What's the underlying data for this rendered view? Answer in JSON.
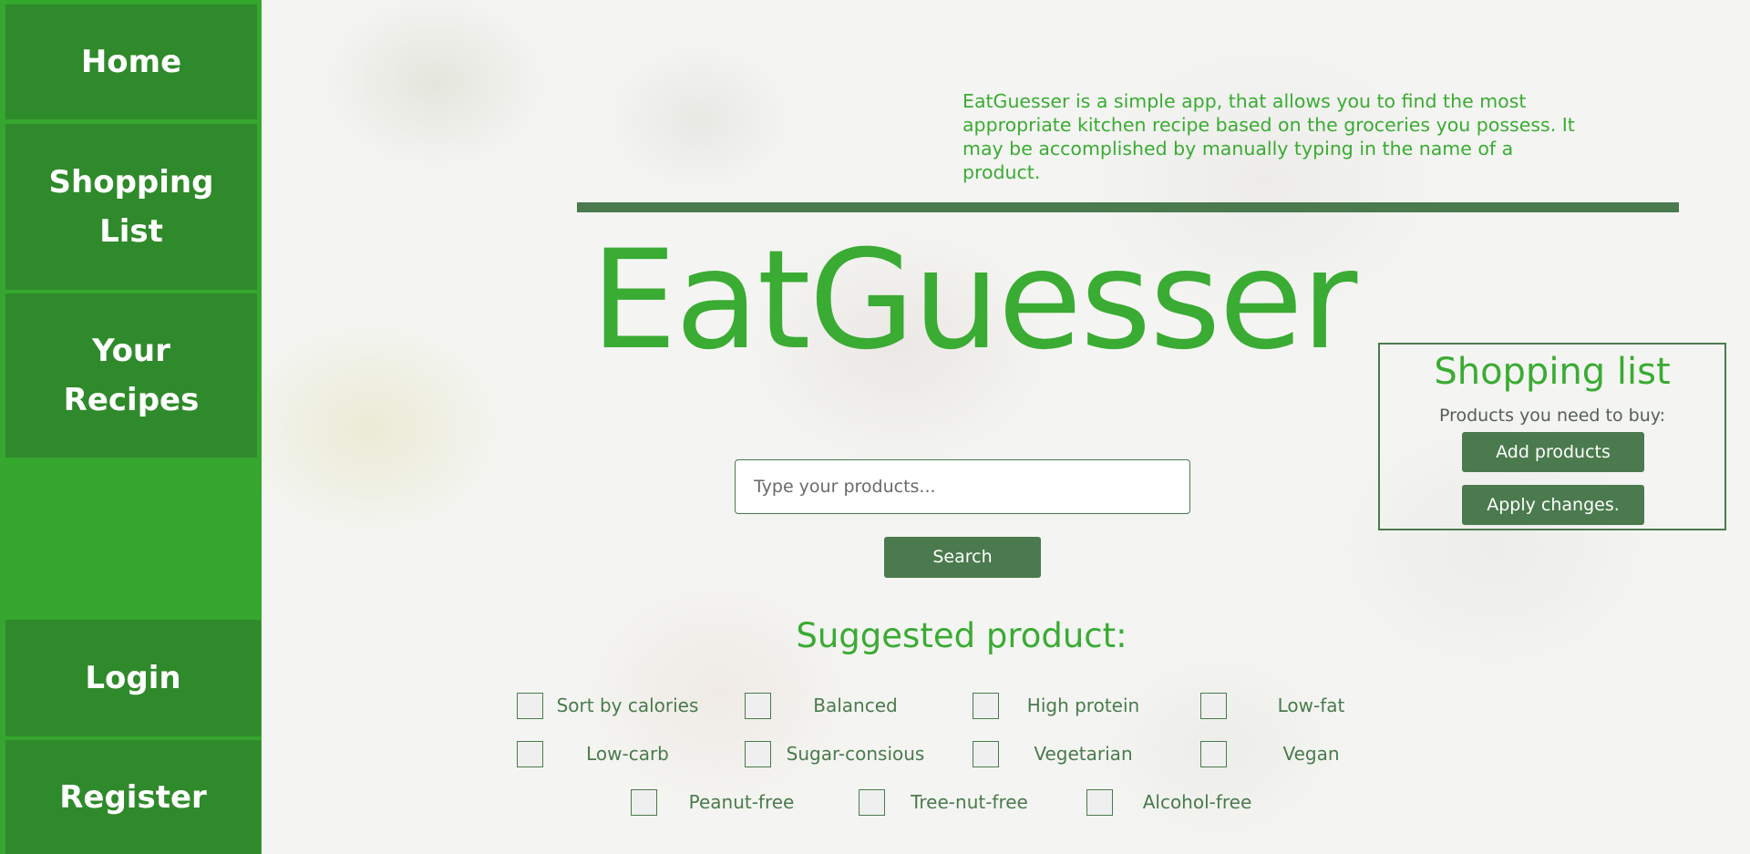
{
  "sidebar": {
    "items": [
      {
        "label": "Home"
      },
      {
        "label": "Shopping List"
      },
      {
        "label": "Your Recipes"
      }
    ],
    "auth": [
      {
        "label": "Login"
      },
      {
        "label": "Register"
      }
    ]
  },
  "main": {
    "description": "EatGuesser is a simple app, that allows you to find the most appropriate kitchen recipe based on the groceries you possess. It may be accomplished by manually typing in the name of a product.",
    "title": "EatGuesser",
    "search": {
      "placeholder": "Type your products...",
      "value": "",
      "button_label": "Search"
    },
    "suggested_title": "Suggested product:",
    "filters": [
      {
        "label": "Sort by calories",
        "checked": false
      },
      {
        "label": "Balanced",
        "checked": false
      },
      {
        "label": "High protein",
        "checked": false
      },
      {
        "label": "Low-fat",
        "checked": false
      },
      {
        "label": "Low-carb",
        "checked": false
      },
      {
        "label": "Sugar-consious",
        "checked": false
      },
      {
        "label": "Vegetarian",
        "checked": false
      },
      {
        "label": "Vegan",
        "checked": false
      },
      {
        "label": "Peanut-free",
        "checked": false
      },
      {
        "label": "Tree-nut-free",
        "checked": false
      },
      {
        "label": "Alcohol-free",
        "checked": false
      }
    ]
  },
  "shopping_panel": {
    "title": "Shopping list",
    "subtitle": "Products you need to buy:",
    "add_label": "Add products",
    "apply_label": "Apply changes."
  },
  "colors": {
    "sidebar_bg": "#35a72e",
    "nav_item_bg": "#2f8a2b",
    "accent_green": "#3aab33",
    "dark_green": "#4a7a4d"
  }
}
